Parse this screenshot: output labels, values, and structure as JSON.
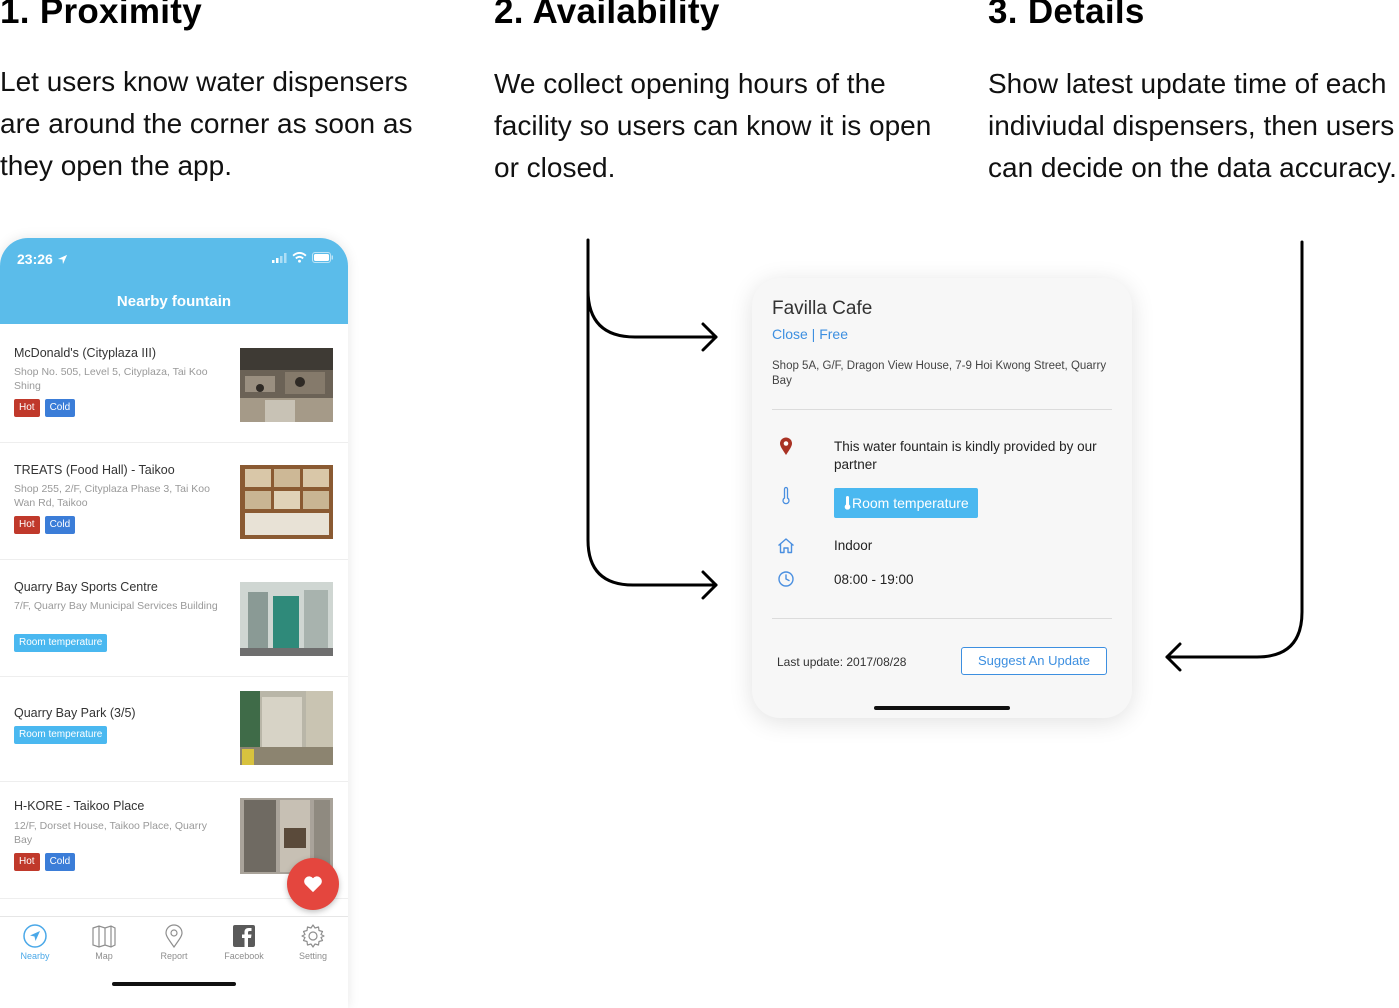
{
  "features": [
    {
      "title": "1. Proximity",
      "lines": [
        "Let users know water dispensers",
        "are around the corner as soon as",
        "they open the app."
      ]
    },
    {
      "title": "2. Availability",
      "lines": [
        "We collect opening hours of the",
        "facility so users can know it is open",
        "or closed."
      ]
    },
    {
      "title": "3. Details",
      "lines": [
        "Show latest update time of each",
        "indiviudal dispensers, then users",
        "can decide on the data accuracy."
      ]
    }
  ],
  "phone": {
    "status_time": "23:26",
    "nav_title": "Nearby fountain",
    "list": [
      {
        "name": "McDonald's (Cityplaza III)",
        "address": "Shop No. 505, Level 5, Cityplaza, Tai Koo Shing",
        "tags": [
          "Hot",
          "Cold"
        ]
      },
      {
        "name": "TREATS (Food Hall) - Taikoo",
        "address": "Shop 255, 2/F, Cityplaza Phase 3, Tai Koo Wan Rd, Taikoo",
        "tags": [
          "Hot",
          "Cold"
        ]
      },
      {
        "name": "Quarry Bay Sports Centre",
        "address": "7/F, Quarry Bay Municipal Services Building",
        "tags": [
          "Room temperature"
        ]
      },
      {
        "name": "Quarry Bay Park (3/5)",
        "address": "",
        "tags": [
          "Room temperature"
        ]
      },
      {
        "name": "H-KORE - Taikoo Place",
        "address": "12/F, Dorset House, Taikoo Place, Quarry Bay",
        "tags": [
          "Hot",
          "Cold"
        ]
      }
    ],
    "tabs": [
      "Nearby",
      "Map",
      "Report",
      "Facebook",
      "Setting"
    ],
    "active_tab": "Nearby"
  },
  "detail": {
    "title": "Favilla Cafe",
    "status": "Close | Free",
    "address": "Shop 5A, G/F, Dragon View House, 7-9 Hoi Kwong Street, Quarry Bay",
    "partner_text": "This water fountain is kindly provided by our partner",
    "temperature": "Room temperature",
    "location_type": "Indoor",
    "hours": "08:00 - 19:00",
    "last_update": "Last update: 2017/08/28",
    "suggest_label": "Suggest An Update"
  },
  "colors": {
    "header_blue": "#5BBCEA",
    "hot_red": "#C0392B",
    "cold_blue": "#3B7DD8",
    "room_blue": "#4AB8F0",
    "link_blue": "#3D8FE0",
    "fab_red": "#E4463E"
  },
  "icons": [
    "location-arrow-icon",
    "signal-icon",
    "wifi-icon",
    "battery-icon",
    "heart-icon",
    "navigation-icon",
    "map-icon",
    "pin-icon",
    "facebook-icon",
    "gear-icon",
    "map-pin-icon",
    "thermometer-icon",
    "home-icon",
    "clock-icon"
  ]
}
